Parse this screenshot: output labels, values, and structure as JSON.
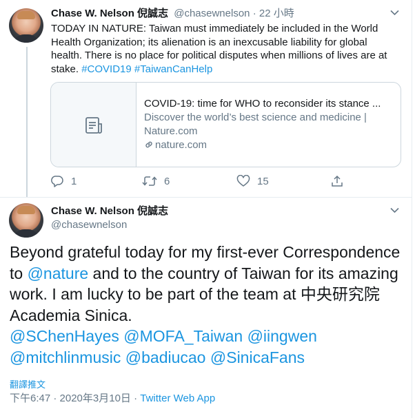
{
  "tweet1": {
    "name": "Chase W. Nelson 倪誠志",
    "handle": "@chasewnelson",
    "separator": "·",
    "time": "22 小時",
    "text": "TODAY IN NATURE: Taiwan must immediately be included in the World Health Organization; its alienation is an inexcusable liability for global health. There is no place for political disputes when millions of lives are at stake.",
    "hashtags": [
      "#COVID19",
      "#TaiwanCanHelp"
    ],
    "card": {
      "title": "COVID-19: time for WHO to reconsider its stance ...",
      "description": "Discover the world’s best science and medicine | Nature.com",
      "domain": "nature.com",
      "thumb_icon": "document-icon",
      "link_icon": "link-icon"
    },
    "actions": {
      "replies": "1",
      "retweets": "6",
      "likes": "15"
    }
  },
  "tweet2": {
    "name": "Chase W. Nelson 倪誠志",
    "handle": "@chasewnelson",
    "text_part1": "Beyond grateful today for my first-ever Correspondence to ",
    "mention_nature": "@nature",
    "text_part2": " and to the country of Taiwan for its amazing work. I am lucky to be part of the team at 中央研究院 Academia Sinica.",
    "mentions": [
      "@SChenHayes",
      "@MOFA_Taiwan",
      "@iingwen",
      "@mitchlinmusic",
      "@badiucao",
      "@SinicaFans"
    ],
    "translate_label": "翻譯推文",
    "timestamp": "下午6:47 · 2020年3月10日",
    "meta_separator": "·",
    "source": "Twitter Web App"
  },
  "colors": {
    "link": "#1b95e0",
    "secondary_text": "#657786",
    "border": "#ccd6dd"
  }
}
